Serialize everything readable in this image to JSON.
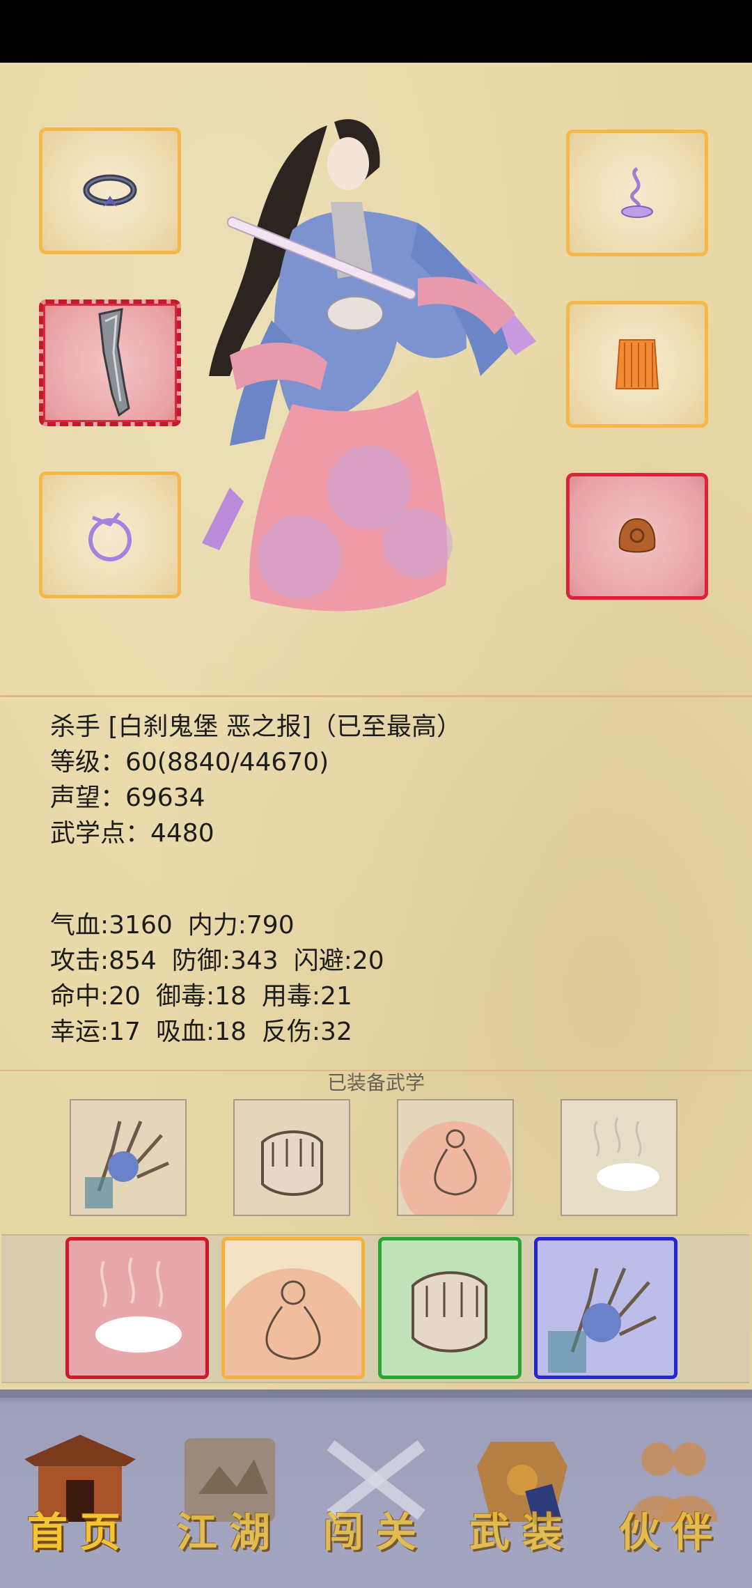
{
  "character": {
    "title_line": "杀手 [白刹鬼堡 恶之报]（已至最高）",
    "level_line": "等级：60(8840/44670)",
    "reputation_line": "声望：69634",
    "martial_points_line": "武学点：4480"
  },
  "attributes": {
    "row1": [
      "气血:3160",
      "内力:790"
    ],
    "row2": [
      "攻击:854",
      "防御:343",
      "闪避:20"
    ],
    "row3": [
      "命中:20",
      "御毒:18",
      "用毒:21"
    ],
    "row4": [
      "幸运:17",
      "吸血:18",
      "反伤:32"
    ]
  },
  "equipped_skills": {
    "label": "已装备武学"
  },
  "equipment_slots": {
    "left": [
      "ring-icon",
      "sword-icon",
      "ribbon-charm-icon"
    ],
    "right": [
      "incense-icon",
      "armor-icon",
      "amulet-icon"
    ]
  },
  "nav": {
    "items": [
      {
        "label": "首页",
        "icon": "house-icon"
      },
      {
        "label": "江湖",
        "icon": "scroll-icon"
      },
      {
        "label": "闯关",
        "icon": "crossed-swords-icon"
      },
      {
        "label": "武装",
        "icon": "armor-icon"
      },
      {
        "label": "伙伴",
        "icon": "partners-icon"
      }
    ]
  },
  "colors": {
    "slot_border": "#f5b74a",
    "rare_border": "#d8233a",
    "skill_red": "#d01a2c",
    "skill_orange": "#f4b13d",
    "skill_green": "#2aa532",
    "skill_blue": "#2424d8",
    "nav_bg": "#a3a5c1",
    "nav_text": "#f4c431"
  }
}
